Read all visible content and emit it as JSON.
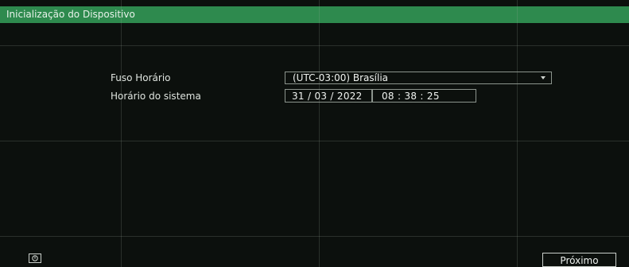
{
  "window": {
    "title": "Inicialização do Dispositivo"
  },
  "form": {
    "timezone_label": "Fuso Horário",
    "timezone_value": "(UTC-03:00) Brasília",
    "system_time_label": "Horário do sistema",
    "date_value": "31 / 03 / 2022",
    "time_value": "08 : 38 : 25"
  },
  "footer": {
    "power_icon": "power-icon",
    "next_label": "Próximo"
  },
  "colors": {
    "titlebar": "#2e8a4e",
    "background": "#0c100d",
    "text": "#dfe4df"
  }
}
